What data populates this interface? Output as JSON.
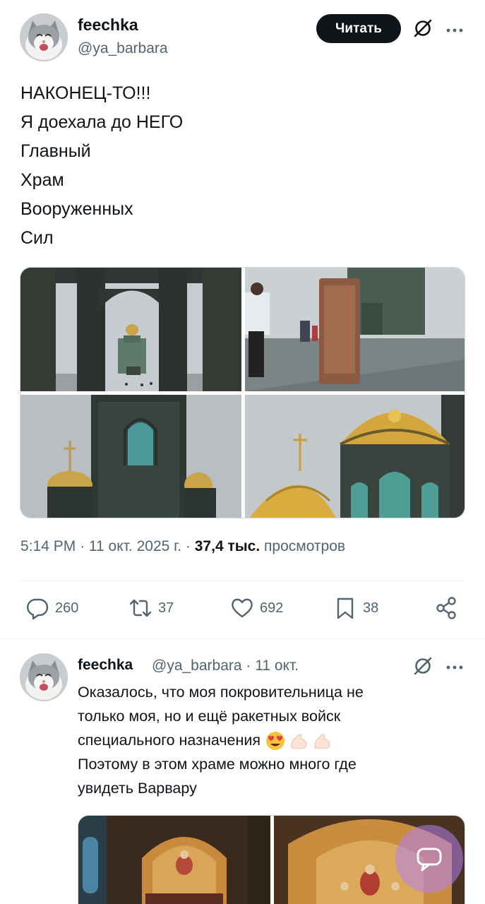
{
  "post1": {
    "display_name": "feechka",
    "handle": "@ya_barbara",
    "follow_label": "Читать",
    "grok_icon": "grok-icon",
    "more_icon": "more-dots-icon",
    "lines": [
      "НАКОНЕЦ-ТО!!!",
      "Я доехала до НЕГО",
      "Главный",
      "Храм",
      "Вооруженных",
      "Сил"
    ],
    "images": [
      "photo-cathedral-arch",
      "photo-square-monument",
      "photo-cathedral-tower",
      "photo-golden-domes"
    ],
    "time": "5:14 PM",
    "date": "11 окт. 2025 г.",
    "views_count": "37,4 тыс.",
    "views_label": "просмотров",
    "actions": {
      "replies": "260",
      "reposts": "37",
      "likes": "692",
      "bookmarks": "38"
    }
  },
  "post2": {
    "display_name": "feechka",
    "handle_and_date": "@ya_barbara · 11 окт.",
    "lines": [
      "Оказалось, что моя покровительница не",
      "только моя, но и ещё ракетных войск",
      "специального назначения",
      "Поэтому в этом храме можно много где",
      "увидеть Варвару"
    ],
    "emojis": [
      "heart-eyes-emoji",
      "flexed-biceps-emoji",
      "flexed-biceps-emoji"
    ],
    "images": [
      "photo-interior-mosaic-left",
      "photo-interior-mosaic-right"
    ]
  },
  "colors": {
    "text": "#0f1419",
    "secondary": "#536471",
    "border": "#cfd9de",
    "follow_bg": "#0f1419",
    "fab": "#b282f0"
  }
}
